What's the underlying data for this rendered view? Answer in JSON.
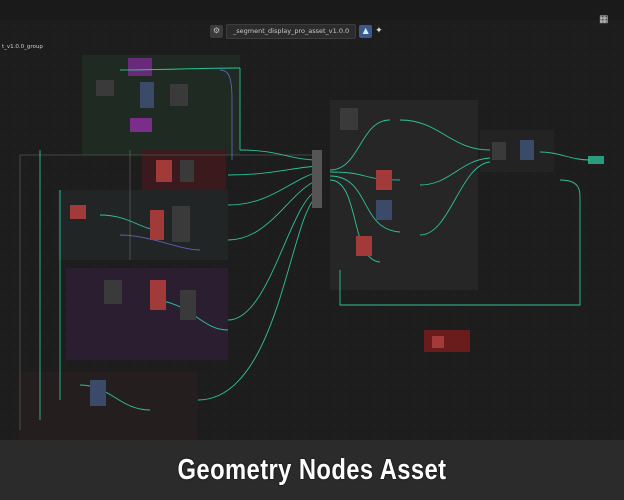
{
  "header": {
    "tree_name": "_segment_display_pro_asset_v1.0.0",
    "group_label": "t_v1.0.0_group",
    "fake_user_icon": "shield-icon",
    "pin_icon": "pin-icon",
    "view_icon": "grid-icon"
  },
  "caption": "Geometry Nodes Asset",
  "colors": {
    "background": "#1d1d1d",
    "link_geometry": "#2fd3a8",
    "link_float": "#9a9a9a",
    "link_vector": "#6a6ad8",
    "frame_red": "#7a1e1e",
    "frame_purple": "#3a1e48",
    "frame_green": "#1e2e24"
  }
}
